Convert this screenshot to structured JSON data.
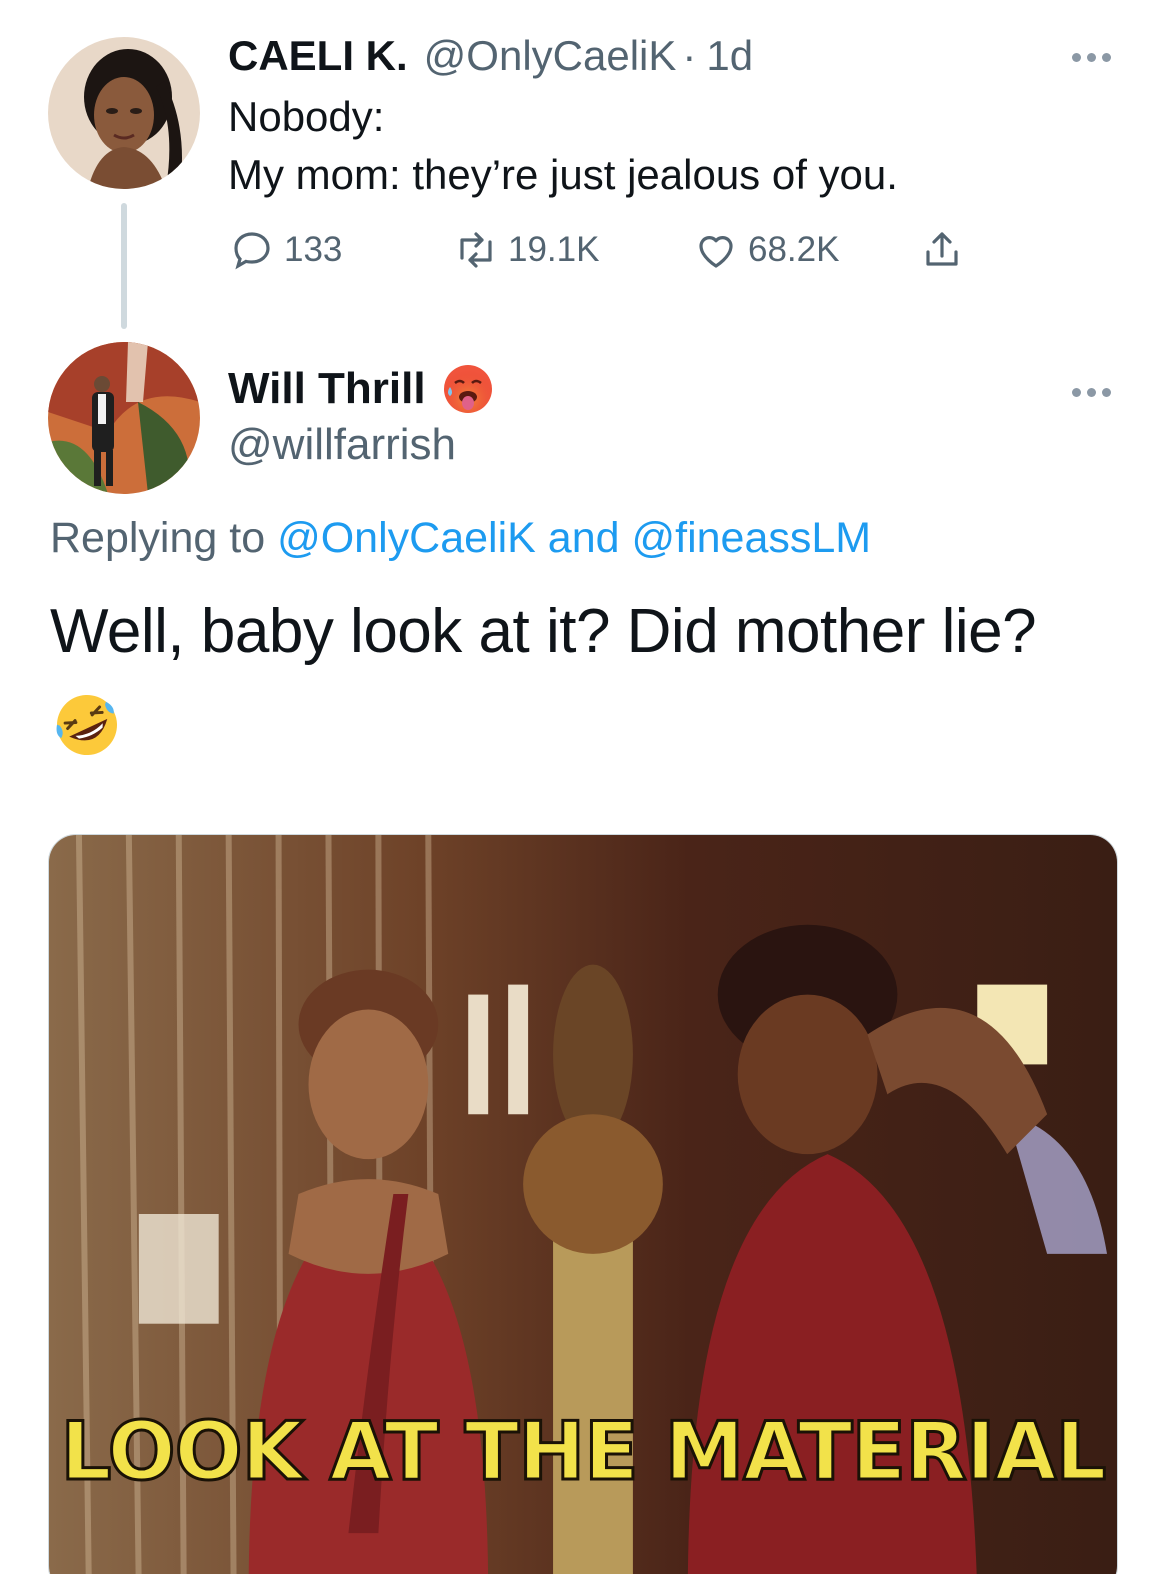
{
  "tweet1": {
    "display_name": "CAELI K.",
    "handle": "@OnlyCaeliK",
    "separator": "·",
    "timestamp": "1d",
    "lines": [
      "Nobody:",
      "My mom: they’re just jealous of you."
    ],
    "stats": {
      "replies": "133",
      "retweets": "19.1K",
      "likes": "68.2K"
    }
  },
  "tweet2": {
    "display_name": "Will Thrill",
    "name_emoji": "hot-face-emoji",
    "handle": "@willfarrish",
    "replying_prefix": "Replying to ",
    "replying_mention_1": "@OnlyCaeliK",
    "replying_and": " and ",
    "replying_mention_2": "@fineassLM",
    "text": "Well, baby look at it? Did mother lie?",
    "trailing_emoji": "rolling-on-floor-laughing-emoji",
    "media": {
      "type": "gif",
      "caption": "LOOK AT THE MATERIAL"
    }
  },
  "icons": [
    "reply-icon",
    "retweet-icon",
    "like-icon",
    "share-icon",
    "more-icon"
  ],
  "colors": {
    "text_primary": "#0f1419",
    "text_secondary": "#536471",
    "link": "#1d9bf0",
    "divider": "#cfd9de",
    "caption_yellow": "#f2e24a"
  }
}
